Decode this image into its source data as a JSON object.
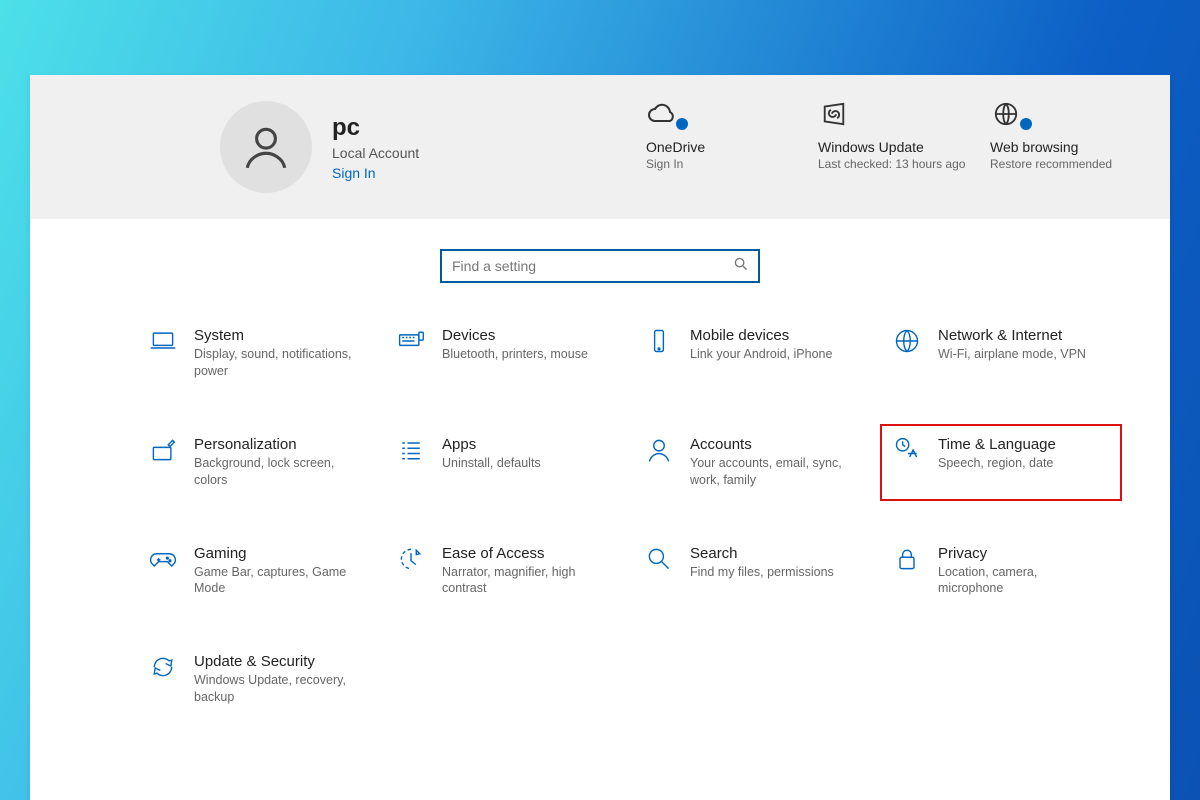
{
  "user": {
    "name": "pc",
    "account_type": "Local Account",
    "sign_in": "Sign In"
  },
  "status": {
    "onedrive": {
      "title": "OneDrive",
      "sub": "Sign In"
    },
    "update": {
      "title": "Windows Update",
      "sub": "Last checked: 13 hours ago"
    },
    "web": {
      "title": "Web browsing",
      "sub": "Restore recommended"
    }
  },
  "search": {
    "placeholder": "Find a setting"
  },
  "categories": [
    {
      "title": "System",
      "desc": "Display, sound, notifications, power"
    },
    {
      "title": "Devices",
      "desc": "Bluetooth, printers, mouse"
    },
    {
      "title": "Mobile devices",
      "desc": "Link your Android, iPhone"
    },
    {
      "title": "Network & Internet",
      "desc": "Wi-Fi, airplane mode, VPN"
    },
    {
      "title": "Personalization",
      "desc": "Background, lock screen, colors"
    },
    {
      "title": "Apps",
      "desc": "Uninstall, defaults"
    },
    {
      "title": "Accounts",
      "desc": "Your accounts, email, sync, work, family"
    },
    {
      "title": "Time & Language",
      "desc": "Speech, region, date"
    },
    {
      "title": "Gaming",
      "desc": "Game Bar, captures, Game Mode"
    },
    {
      "title": "Ease of Access",
      "desc": "Narrator, magnifier, high contrast"
    },
    {
      "title": "Search",
      "desc": "Find my files, permissions"
    },
    {
      "title": "Privacy",
      "desc": "Location, camera, microphone"
    },
    {
      "title": "Update & Security",
      "desc": "Windows Update, recovery, backup"
    }
  ],
  "highlighted_index": 7
}
